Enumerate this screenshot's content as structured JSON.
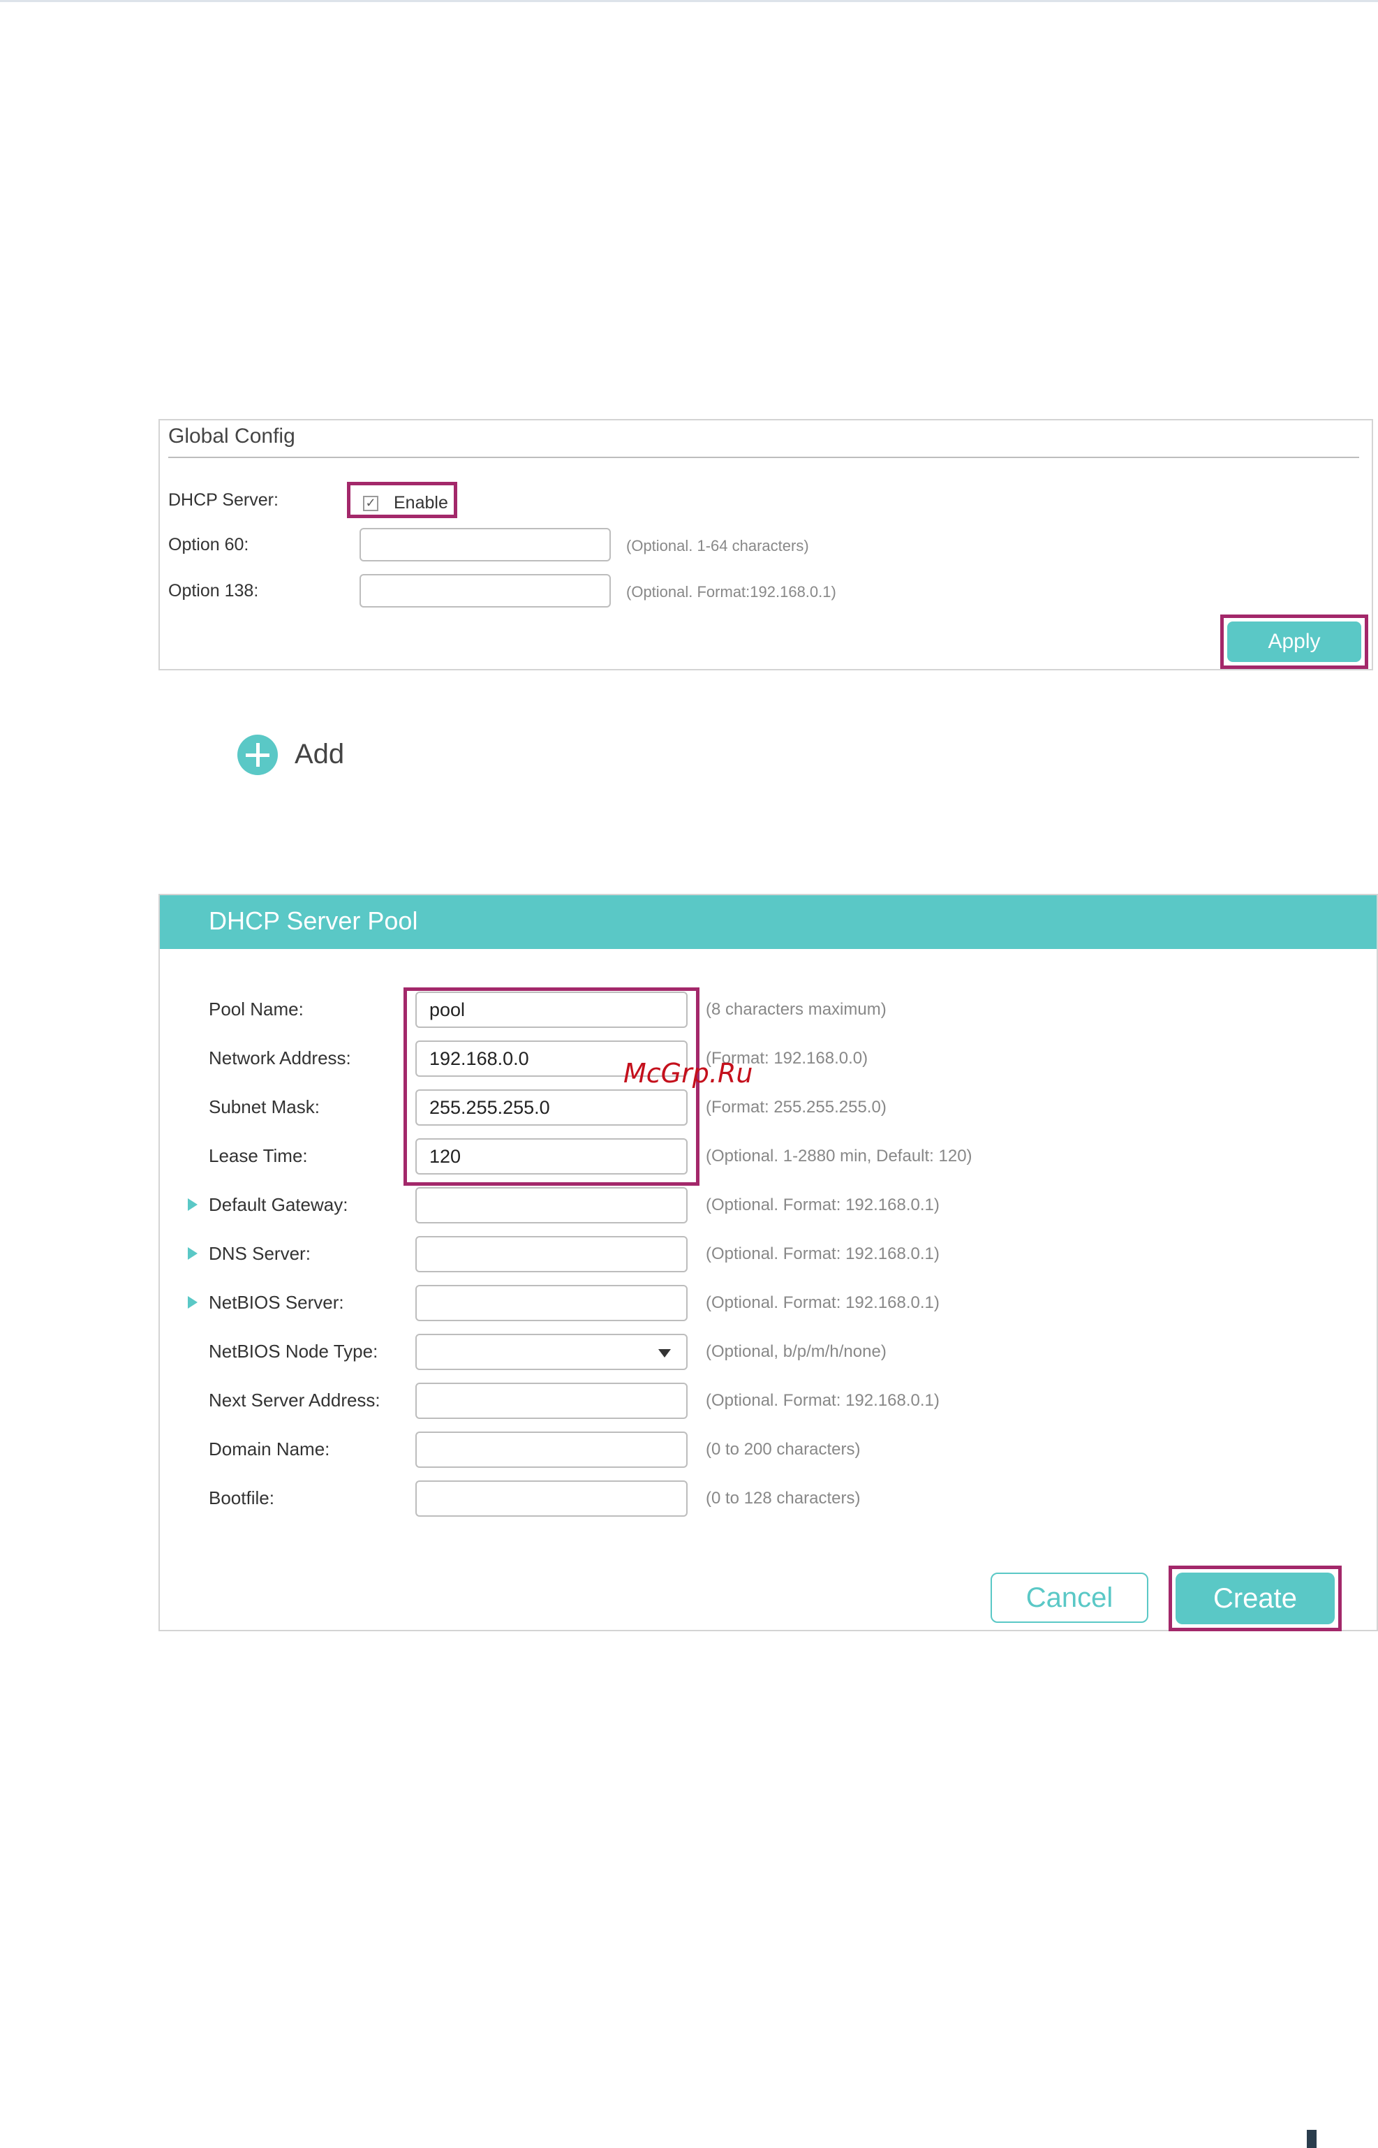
{
  "global_config": {
    "title": "Global Config",
    "dhcp_server_label": "DHCP Server:",
    "enable_label": "Enable",
    "enable_checked": true,
    "option60_label": "Option 60:",
    "option60_value": "",
    "option60_hint": "(Optional. 1-64 characters)",
    "option138_label": "Option 138:",
    "option138_value": "",
    "option138_hint": "(Optional. Format:192.168.0.1)",
    "apply_label": "Apply"
  },
  "add": {
    "label": "Add"
  },
  "pool": {
    "title": "DHCP Server Pool",
    "rows": [
      {
        "label": "Pool Name:",
        "value": "pool",
        "hint": "(8 characters maximum)"
      },
      {
        "label": "Network Address:",
        "value": "192.168.0.0",
        "hint": "(Format: 192.168.0.0)"
      },
      {
        "label": "Subnet Mask:",
        "value": "255.255.255.0",
        "hint": "(Format: 255.255.255.0)"
      },
      {
        "label": "Lease Time:",
        "value": "120",
        "hint": "(Optional. 1-2880 min, Default: 120)"
      },
      {
        "label": "Default Gateway:",
        "value": "",
        "hint": "(Optional. Format: 192.168.0.1)"
      },
      {
        "label": "DNS Server:",
        "value": "",
        "hint": "(Optional. Format: 192.168.0.1)"
      },
      {
        "label": "NetBIOS Server:",
        "value": "",
        "hint": "(Optional. Format: 192.168.0.1)"
      },
      {
        "label": "NetBIOS Node Type:",
        "value": "",
        "hint": "(Optional, b/p/m/h/none)"
      },
      {
        "label": "Next Server Address:",
        "value": "",
        "hint": "(Optional. Format: 192.168.0.1)"
      },
      {
        "label": "Domain Name:",
        "value": "",
        "hint": "(0 to 200 characters)"
      },
      {
        "label": "Bootfile:",
        "value": "",
        "hint": "(0 to 128 characters)"
      }
    ],
    "cancel_label": "Cancel",
    "create_label": "Create"
  },
  "watermark": "McGrp.Ru",
  "colors": {
    "accent": "#5ac8c6",
    "highlight": "#a3286a",
    "watermark": "#c4101c"
  },
  "icons": {
    "add": "plus-circle-icon",
    "checkbox": "check-icon",
    "expand": "triangle-right-icon",
    "dropdown": "caret-down-icon"
  }
}
